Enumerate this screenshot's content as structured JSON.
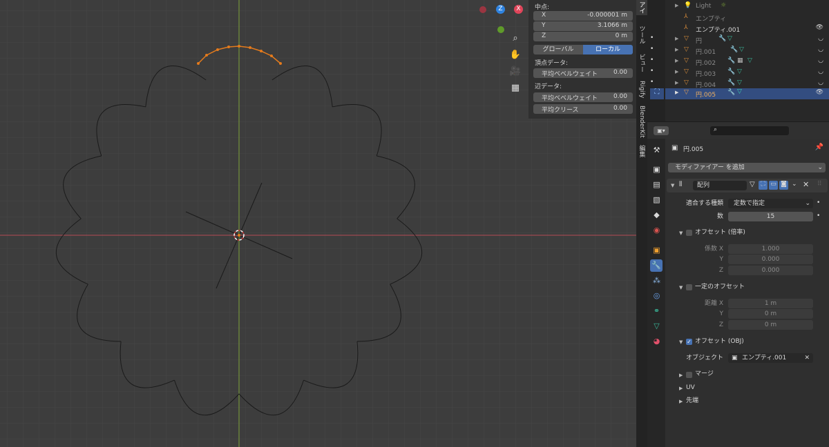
{
  "viewport": {
    "gizmo_z": "Z",
    "gizmo_x": "X"
  },
  "npanel": {
    "median_label": "中点:",
    "x_label": "X",
    "x_value": "-0.000001 m",
    "y_label": "Y",
    "y_value": "3.1066 m",
    "z_label": "Z",
    "z_value": "0 m",
    "global_btn": "グローバル",
    "local_btn": "ローカル",
    "vertex_data_label": "頂点データ:",
    "vertex_bevel_label": "平均ベベルウェイト",
    "vertex_bevel_value": "0.00",
    "edge_data_label": "辺データ:",
    "edge_bevel_label": "平均ベベルウェイト",
    "edge_bevel_value": "0.00",
    "crease_label": "平均クリース",
    "crease_value": "0.00"
  },
  "vtabs": [
    "アイ",
    "ツール",
    "ビュー",
    "Rigify",
    "BlenderKit",
    "編集"
  ],
  "outliner": {
    "rows": [
      {
        "name": "Light"
      },
      {
        "name": "エンプティ"
      },
      {
        "name": "エンプティ.001"
      },
      {
        "name": "円"
      },
      {
        "name": "円.001"
      },
      {
        "name": "円.002"
      },
      {
        "name": "円.003"
      },
      {
        "name": "円.004"
      },
      {
        "name": "円.005"
      }
    ]
  },
  "props": {
    "object_name": "円.005",
    "add_modifier": "モディファイアー を追加",
    "modifier_name": "配列",
    "fit_type_label": "適合する種類",
    "fit_type_value": "定数で指定",
    "count_label": "数",
    "count_value": "15",
    "rel_offset_label": "オフセット (倍率)",
    "factor_x_label": "係数 X",
    "factor_x_value": "1.000",
    "factor_y_label": "Y",
    "factor_y_value": "0.000",
    "factor_z_label": "Z",
    "factor_z_value": "0.000",
    "const_offset_label": "一定のオフセット",
    "dist_x_label": "距離 X",
    "dist_x_value": "1 m",
    "dist_y_label": "Y",
    "dist_y_value": "0 m",
    "dist_z_label": "Z",
    "dist_z_value": "0 m",
    "obj_offset_label": "オフセット (OBJ)",
    "object_label": "オブジェクト",
    "object_value": "エンプティ.001",
    "merge_label": "マージ",
    "uv_label": "UV",
    "cap_label": "先端"
  },
  "colors": {
    "x_axis": "#b84a55",
    "y_axis": "#7da23a",
    "selected": "#e57b1c",
    "active_blue": "#4772b3",
    "highlight_row": "#334d80"
  }
}
